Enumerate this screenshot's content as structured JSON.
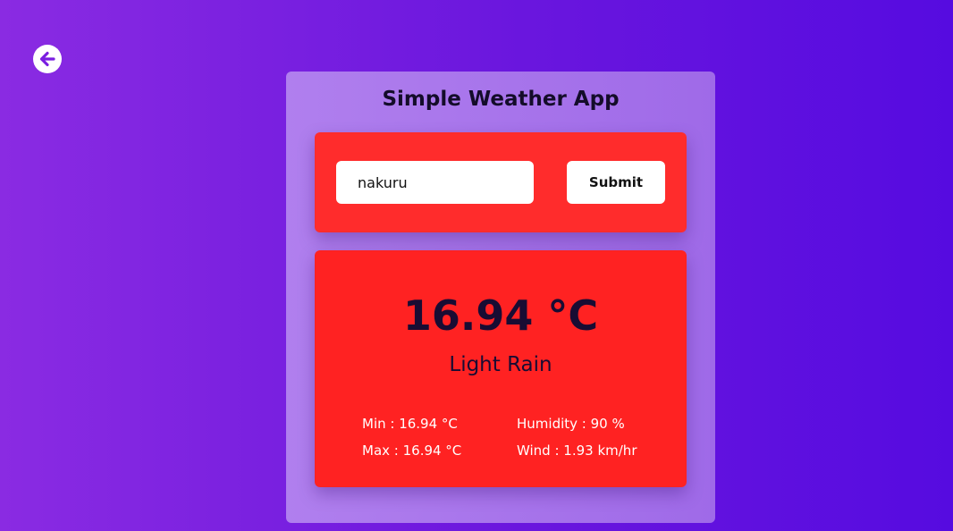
{
  "back": {
    "icon": "arrow-left-circle-icon",
    "color": "#7a1fe0"
  },
  "app": {
    "title": "Simple Weather App"
  },
  "search": {
    "value": "nakuru",
    "submit_label": "Submit"
  },
  "weather": {
    "temperature": "16.94 °C",
    "condition": "Light Rain",
    "min": "Min : 16.94 °C",
    "max": "Max : 16.94 °C",
    "humidity": "Humidity : 90 %",
    "wind": "Wind : 1.93 km/hr"
  },
  "colors": {
    "background_start": "#8a2be2",
    "background_end": "#560be0",
    "card": "#a878ec",
    "panel": "#ff2c2c",
    "text_dark": "#190c33"
  }
}
